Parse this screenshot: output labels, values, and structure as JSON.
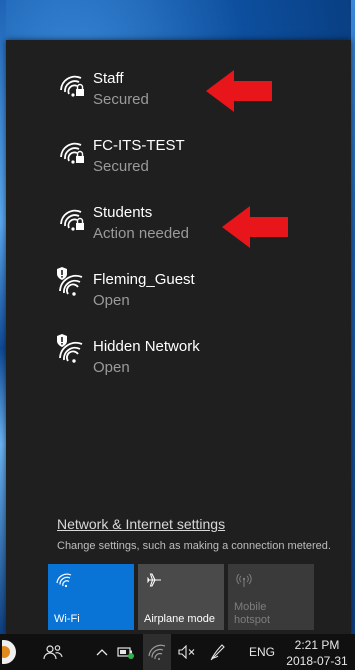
{
  "networks": [
    {
      "name": "Staff",
      "status": "Secured",
      "icon": "wifi-secured-icon"
    },
    {
      "name": "FC-ITS-TEST",
      "status": "Secured",
      "icon": "wifi-secured-icon"
    },
    {
      "name": "Students",
      "status": "Action needed",
      "icon": "wifi-secured-icon"
    },
    {
      "name": "Fleming_Guest",
      "status": "Open",
      "icon": "wifi-open-shield-icon"
    },
    {
      "name": "Hidden Network",
      "status": "Open",
      "icon": "wifi-open-shield-icon"
    }
  ],
  "settings": {
    "link": "Network & Internet settings",
    "description": "Change settings, such as making a connection metered."
  },
  "quick_actions": [
    {
      "label": "Wi-Fi",
      "state": "on",
      "icon": "wifi-icon"
    },
    {
      "label": "Airplane mode",
      "state": "off",
      "icon": "airplane-icon"
    },
    {
      "label": "Mobile\nhotspot",
      "state": "disabled",
      "icon": "hotspot-icon"
    }
  ],
  "taskbar": {
    "language": "ENG",
    "time": "2:21 PM",
    "date": "2018-07-31"
  },
  "colors": {
    "flyout_bg": "#1f1f1f",
    "accent": "#0a74d6",
    "annotation_arrow": "#e8151b"
  }
}
